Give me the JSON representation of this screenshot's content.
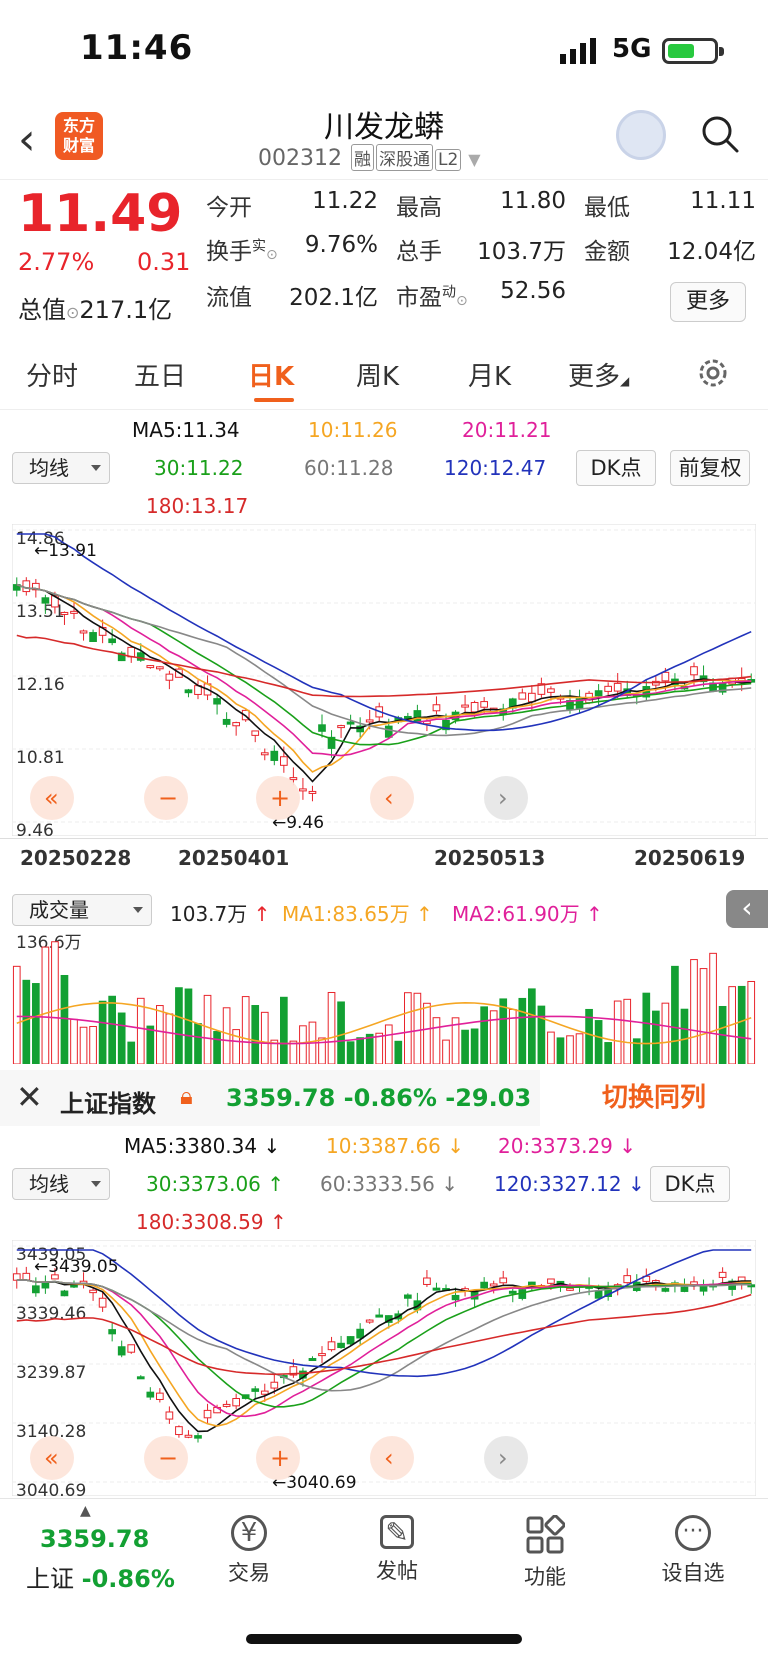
{
  "status": {
    "time": "11:46",
    "network": "5G"
  },
  "header": {
    "logo_text": "东方财富",
    "stock_name": "川发龙蟒",
    "stock_code": "002312",
    "tags": [
      "融",
      "深股通",
      "L2"
    ]
  },
  "quote": {
    "price": "11.49",
    "change_pct": "2.77%",
    "change": "0.31",
    "open_label": "今开",
    "open_value": "11.22",
    "high_label": "最高",
    "high_value": "11.80",
    "low_label": "最低",
    "low_value": "11.11",
    "turnover_label": "换手",
    "turnover_sup": "实",
    "turnover_value": "9.76%",
    "volume_label": "总手",
    "volume_value": "103.7万",
    "amount_label": "金额",
    "amount_value": "12.04亿",
    "mktcap_label": "总值",
    "mktcap_value": "217.1亿",
    "float_label": "流值",
    "float_value": "202.1亿",
    "pe_label": "市盈",
    "pe_sup": "动",
    "pe_value": "52.56",
    "more_label": "更多"
  },
  "tabs": [
    "分时",
    "五日",
    "日K",
    "周K",
    "月K",
    "更多"
  ],
  "active_tab": "日K",
  "kline": {
    "indicator": "均线",
    "ma5": "MA5:11.34",
    "ma10": "10:11.26",
    "ma20": "20:11.21",
    "ma30": "30:11.22",
    "ma60": "60:11.28",
    "ma120": "120:12.47",
    "ma180": "180:13.17",
    "dk_label": "DK点",
    "adjust_label": "前复权",
    "y_ticks": [
      "14.86",
      "13.51",
      "12.16",
      "10.81",
      "9.46"
    ],
    "hi_label": "13.91",
    "lo_label": "9.46",
    "dates": [
      "20250228",
      "20250401",
      "20250513",
      "20250619"
    ],
    "colors": {
      "ma5": "#111111",
      "ma10": "#f5a623",
      "ma20": "#e0209a",
      "ma30": "#1aa01a",
      "ma60": "#888888",
      "ma120": "#2233bb",
      "ma180": "#d62a2a"
    }
  },
  "volume": {
    "indicator": "成交量",
    "value": "103.7万",
    "ma1": "MA1:83.65万",
    "ma2": "MA2:61.90万",
    "max_label": "136.6万"
  },
  "index": {
    "name": "上证指数",
    "value": "3359.78",
    "change_pct": "-0.86%",
    "change": "-29.03",
    "switch_label": "切换同列",
    "ma5": "MA5:3380.34",
    "ma10": "10:3387.66",
    "ma20": "20:3373.29",
    "ma30": "30:3373.06",
    "ma60": "60:3333.56",
    "ma120": "120:3327.12",
    "ma180": "180:3308.59",
    "indicator": "均线",
    "dk_label": "DK点",
    "y_ticks": [
      "3439.05",
      "3339.46",
      "3239.87",
      "3140.28",
      "3040.69"
    ],
    "hi_label": "3439.05",
    "lo_label": "3040.69"
  },
  "bottom": {
    "index_value": "3359.78",
    "index_name": "上证",
    "index_pct": "-0.86%",
    "items": [
      "交易",
      "发帖",
      "功能",
      "设自选"
    ]
  }
}
